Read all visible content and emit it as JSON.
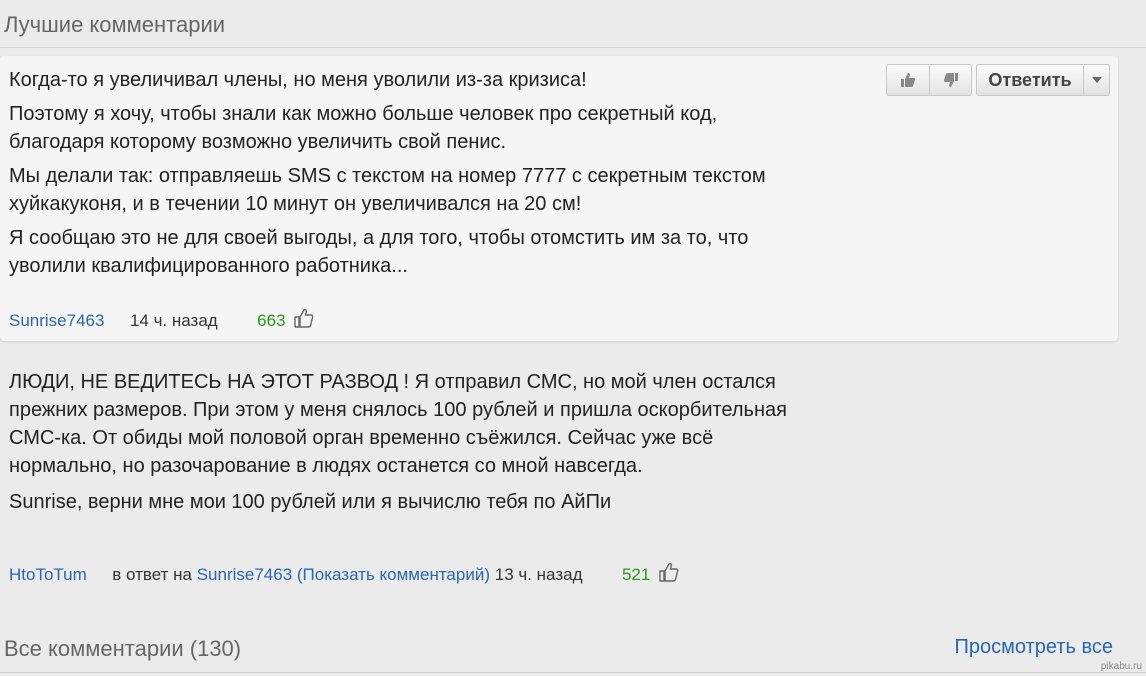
{
  "best_section": {
    "title": "Лучшие комментарии"
  },
  "toolbar": {
    "reply_label": "Ответить",
    "like_icon": "thumb-up-icon",
    "dislike_icon": "thumb-down-icon",
    "dropdown_icon": "caret-down-icon"
  },
  "comments": [
    {
      "paragraphs": [
        "Когда-то я увеличивал члены, но меня уволили из-за кризиса!",
        "Поэтому я хочу, чтобы знали как можно больше человек про секретный код, благодаря которому возможно увеличить свой пенис.",
        "Мы делали так: отправляешь SMS с текстом на номер 7777 с секретным текстом хуйкакуконя, и в течении 10 минут он увеличивался на 20 см!",
        "Я сообщаю это не для своей выгоды, а для того, чтобы отомстить им за то, что уволили квалифицированного работника..."
      ],
      "author": "Sunrise7463",
      "time": "14 ч. назад",
      "likes": "663"
    },
    {
      "paragraphs": [
        "ЛЮДИ, НЕ ВЕДИТЕСЬ НА ЭТОТ РАЗВОД ! Я отправил СМС, но мой член остался прежних размеров. При этом у меня снялось 100 рублей и пришла оскорбительная СМС-ка. От обиды мой половой орган временно съёжился. Сейчас уже всё нормально, но разочарование в людях останется со мной навсегда.",
        "Sunrise, верни мне мои 100 рублей или я вычислю тебя по АйПи"
      ],
      "author": "HtoToTum",
      "reply_prefix": "в ответ на",
      "reply_to": "Sunrise7463 (Показать комментарий)",
      "time": "13 ч. назад",
      "likes": "521"
    }
  ],
  "all_section": {
    "title": "Все комментарии (130)",
    "view_all_label": "Просмотреть все"
  },
  "watermark": "pikabu.ru",
  "colors": {
    "link": "#2a67b1",
    "likes": "#2a9a18",
    "background": "#ebebeb",
    "card": "#f5f5f5"
  }
}
